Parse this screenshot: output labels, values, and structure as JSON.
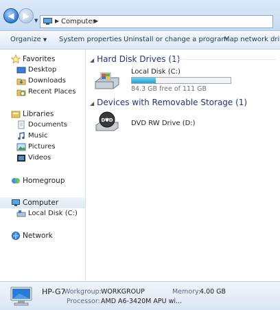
{
  "address": {
    "crumbs": [
      "Computer"
    ]
  },
  "toolbar": {
    "organize": "Organize",
    "system_properties": "System properties",
    "uninstall": "Uninstall or change a program",
    "map_drive": "Map network drive"
  },
  "nav": {
    "favorites": "Favorites",
    "desktop": "Desktop",
    "downloads": "Downloads",
    "recent": "Recent Places",
    "libraries": "Libraries",
    "documents": "Documents",
    "music": "Music",
    "pictures": "Pictures",
    "videos": "Videos",
    "homegroup": "Homegroup",
    "computer": "Computer",
    "localdisk": "Local Disk (C:)",
    "network": "Network"
  },
  "content": {
    "hdd_group": "Hard Disk Drives (1)",
    "local_disk": {
      "name": "Local Disk (C:)",
      "free": "84.3 GB free of 111 GB",
      "used_fraction": 0.24
    },
    "removable_group": "Devices with Removable Storage (1)",
    "dvd": {
      "name": "DVD RW Drive (D:)",
      "icon_label": "DVD"
    }
  },
  "details": {
    "computer_name": "HP-G7",
    "workgroup_label": "Workgroup:",
    "workgroup": "WORKGROUP",
    "memory_label": "Memory:",
    "memory": "4.00 GB",
    "processor_label": "Processor:",
    "processor": "AMD A6-3420M APU wi..."
  },
  "colors": {
    "group_header": "#1e3287",
    "selection": "#dde9f6",
    "bar_fill": "#26a0da"
  }
}
